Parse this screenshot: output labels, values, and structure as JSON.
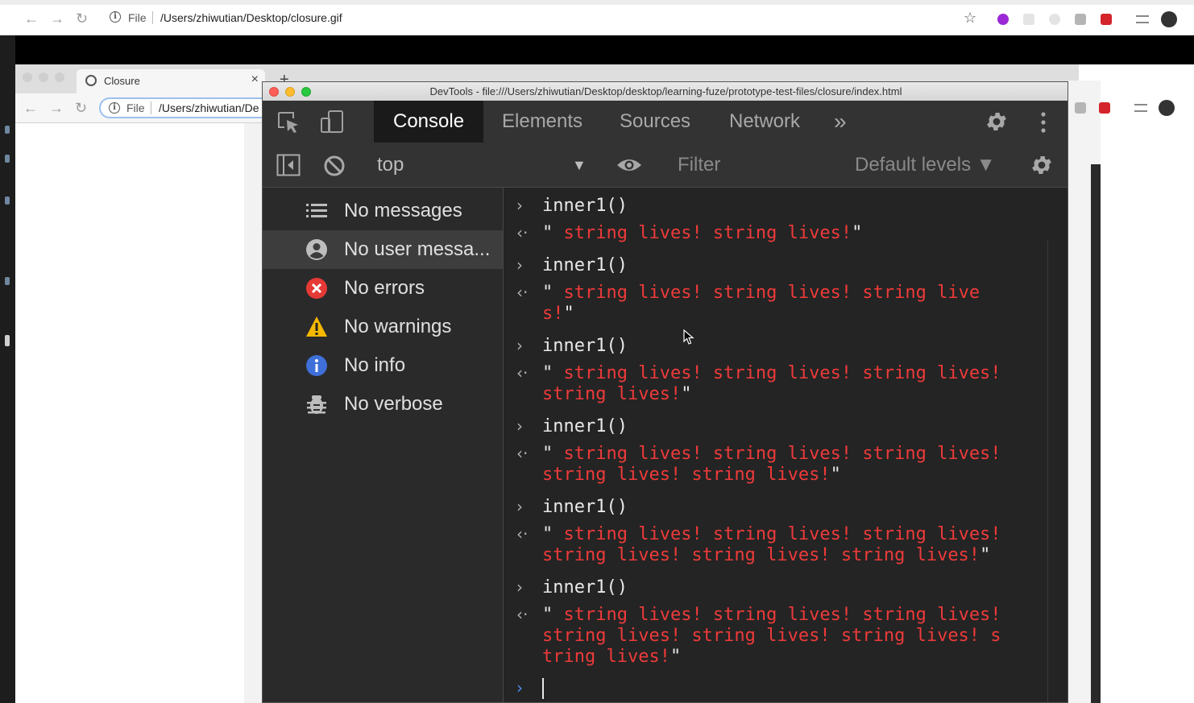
{
  "outer_browser": {
    "url_scheme": "File",
    "url_path": "/Users/zhiwutian/Desktop/closure.gif"
  },
  "inner_browser": {
    "tab_title": "Closure",
    "url_scheme": "File",
    "url_path": "/Users/zhiwutian/De"
  },
  "devtools": {
    "window_title": "DevTools - file:///Users/zhiwutian/Desktop/desktop/learning-fuze/prototype-test-files/closure/index.html",
    "tabs": [
      {
        "label": "Console",
        "active": true
      },
      {
        "label": "Elements",
        "active": false
      },
      {
        "label": "Sources",
        "active": false
      },
      {
        "label": "Network",
        "active": false
      }
    ],
    "more_tabs": "»",
    "toolbar": {
      "context": "top",
      "filter_placeholder": "Filter",
      "levels": "Default levels ▼"
    },
    "sidebar": [
      {
        "label": "No messages",
        "icon": "list-icon",
        "selected": false
      },
      {
        "label": "No user messa...",
        "icon": "user-icon",
        "selected": true
      },
      {
        "label": "No errors",
        "icon": "error-icon",
        "selected": false
      },
      {
        "label": "No warnings",
        "icon": "warning-icon",
        "selected": false
      },
      {
        "label": "No info",
        "icon": "info-icon",
        "selected": false
      },
      {
        "label": "No verbose",
        "icon": "bug-icon",
        "selected": false
      }
    ],
    "console": [
      {
        "input": "inner1()",
        "result": "string lives! string lives!"
      },
      {
        "input": "inner1()",
        "result": "string lives! string lives! string lives!"
      },
      {
        "input": "inner1()",
        "result": "string lives! string lives! string lives! string lives!"
      },
      {
        "input": "inner1()",
        "result": "string lives! string lives! string lives! string lives! string lives!"
      },
      {
        "input": "inner1()",
        "result": "string lives! string lives! string lives! string lives! string lives! string lives!"
      },
      {
        "input": "inner1()",
        "result": "string lives! string lives! string lives! string lives! string lives! string lives! string lives!"
      }
    ]
  },
  "colors": {
    "result_red": "#ee3a3a",
    "devtools_bg": "#242424",
    "prompt_blue": "#4d8ff5"
  }
}
